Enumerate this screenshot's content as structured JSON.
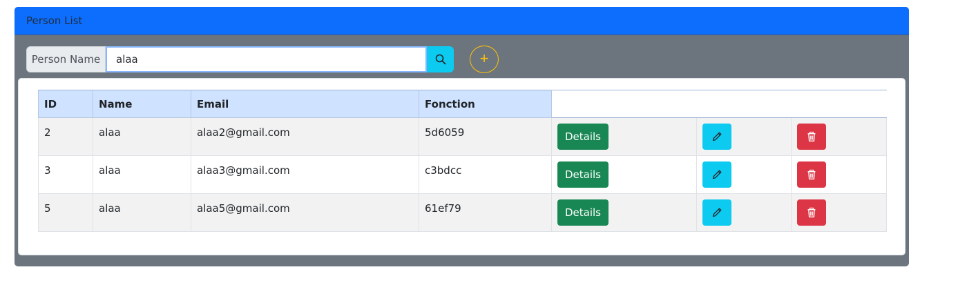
{
  "header": {
    "title": "Person List"
  },
  "search": {
    "label": "Person Name",
    "value": "alaa",
    "icon": "search-icon"
  },
  "add_button": {
    "icon": "plus-icon",
    "glyph": "+"
  },
  "table": {
    "columns": [
      "ID",
      "Name",
      "Email",
      "Fonction"
    ],
    "rows": [
      {
        "id": "2",
        "name": "alaa",
        "email": "alaa2@gmail.com",
        "fonction": "5d6059"
      },
      {
        "id": "3",
        "name": "alaa",
        "email": "alaa3@gmail.com",
        "fonction": "c3bdcc"
      },
      {
        "id": "5",
        "name": "alaa",
        "email": "alaa5@gmail.com",
        "fonction": "61ef79"
      }
    ],
    "details_label": "Details",
    "edit_icon": "pencil-icon",
    "delete_icon": "trash-icon"
  },
  "colors": {
    "primary": "#0d6efd",
    "secondary": "#6c757d",
    "success": "#198754",
    "info": "#0dcaf0",
    "danger": "#dc3545",
    "warning": "#ffc107",
    "table_head": "#cfe2ff"
  }
}
